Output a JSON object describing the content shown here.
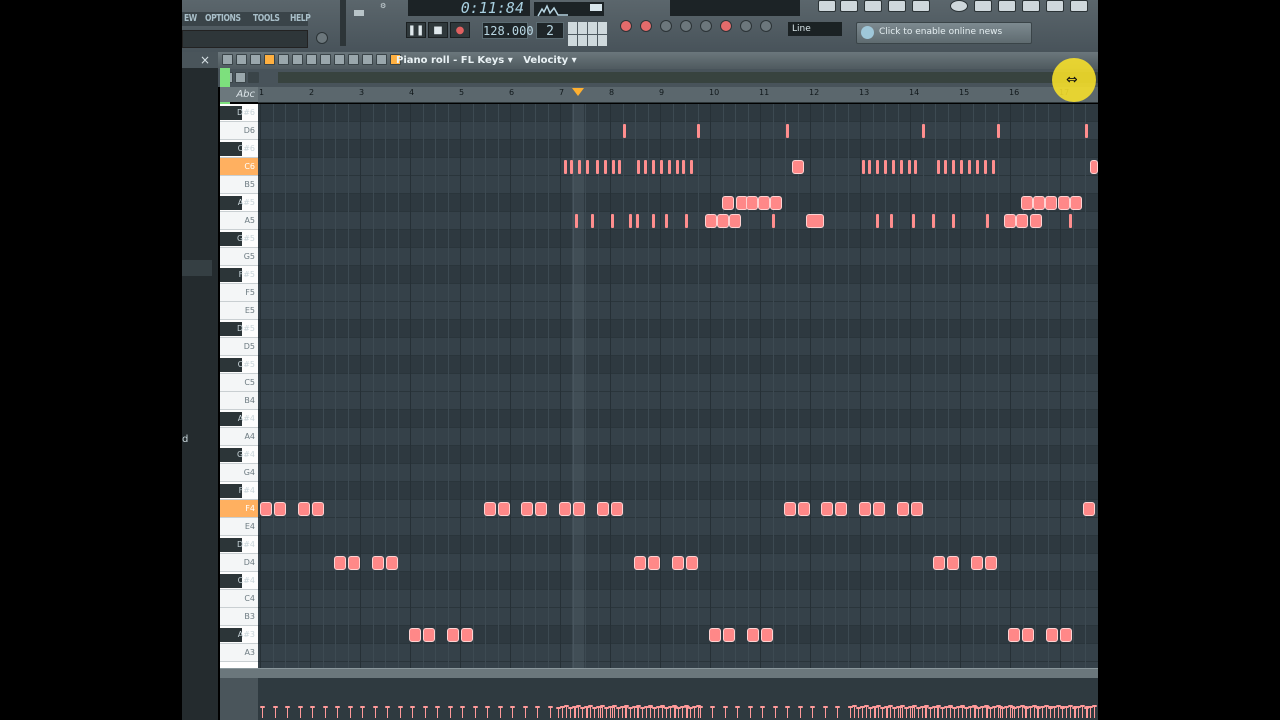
{
  "menubar": {
    "items": [
      "EW",
      "OPTIONS",
      "TOOLS",
      "HELP"
    ]
  },
  "transport": {
    "time": "0:11:84",
    "tempo": "128.000",
    "pattern": "2",
    "snap": "Line",
    "play_label": "▶",
    "stop_label": "■",
    "record_label": "●",
    "pause_label": "❚❚"
  },
  "news": {
    "text": "Click to enable online news"
  },
  "browser": {
    "close": "×",
    "fragment": "d"
  },
  "piano_roll": {
    "title": "Piano roll - FL Keys",
    "target": "Velocity",
    "title_sep": "▾",
    "abc": "Abc",
    "bar_numbers": [
      "1",
      "2",
      "3",
      "4",
      "5",
      "6",
      "7",
      "8",
      "9",
      "10",
      "11",
      "12",
      "13",
      "14",
      "15",
      "16",
      "17"
    ],
    "keys": [
      {
        "name": "D#6",
        "type": "black"
      },
      {
        "name": "D6",
        "type": "white"
      },
      {
        "name": "C#6",
        "type": "black"
      },
      {
        "name": "C6",
        "type": "white",
        "highlight": true
      },
      {
        "name": "B5",
        "type": "white"
      },
      {
        "name": "A#5",
        "type": "black"
      },
      {
        "name": "A5",
        "type": "white"
      },
      {
        "name": "G#5",
        "type": "black"
      },
      {
        "name": "G5",
        "type": "white"
      },
      {
        "name": "F#5",
        "type": "black"
      },
      {
        "name": "F5",
        "type": "white"
      },
      {
        "name": "E5",
        "type": "white"
      },
      {
        "name": "D#5",
        "type": "black"
      },
      {
        "name": "D5",
        "type": "white"
      },
      {
        "name": "C#5",
        "type": "black"
      },
      {
        "name": "C5",
        "type": "white"
      },
      {
        "name": "B4",
        "type": "white"
      },
      {
        "name": "A#4",
        "type": "black"
      },
      {
        "name": "A4",
        "type": "white"
      },
      {
        "name": "G#4",
        "type": "black"
      },
      {
        "name": "G4",
        "type": "white"
      },
      {
        "name": "F#4",
        "type": "black"
      },
      {
        "name": "F4",
        "type": "white",
        "highlight": true
      },
      {
        "name": "E4",
        "type": "white"
      },
      {
        "name": "D#4",
        "type": "black"
      },
      {
        "name": "D4",
        "type": "white"
      },
      {
        "name": "C#4",
        "type": "black"
      },
      {
        "name": "C4",
        "type": "white"
      },
      {
        "name": "B3",
        "type": "white"
      },
      {
        "name": "A#3",
        "type": "black"
      },
      {
        "name": "A3",
        "type": "white"
      }
    ]
  }
}
